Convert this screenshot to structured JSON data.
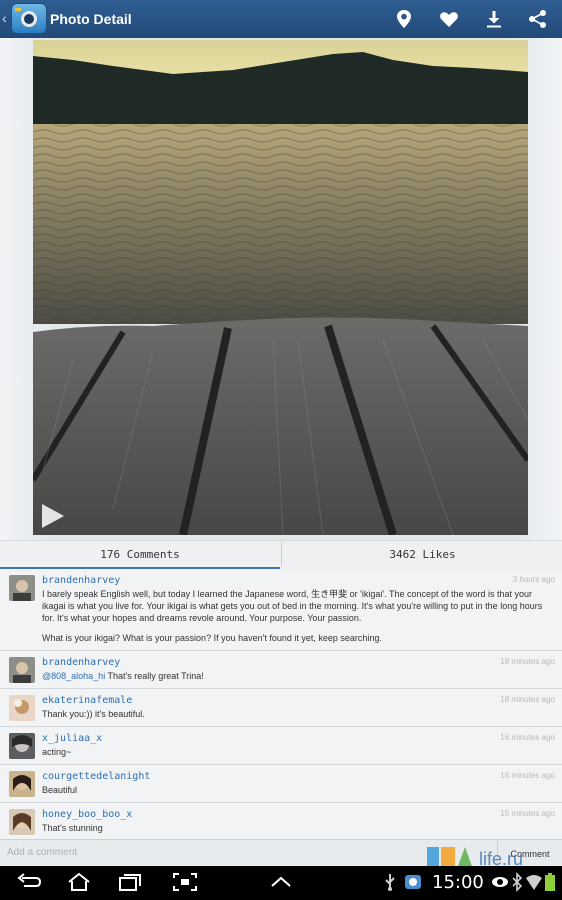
{
  "header": {
    "title": "Photo Detail",
    "icons": [
      "back-chevron",
      "app-logo",
      "location-pin-icon",
      "heart-icon",
      "download-icon",
      "share-icon"
    ]
  },
  "tabs": {
    "comments": "176 Comments",
    "likes": "3462 Likes"
  },
  "comments": [
    {
      "user": "brandenharvey",
      "time": "3 hours ago",
      "text": "I barely speak English well, but today I learned the Japanese word, 生き甲斐 or 'ikigai'. The concept of the word is that your ikagai is what you live for. Your ikigai is what gets you out of bed in the morning. It's what you're willing to put in the long hours for. It's what your hopes and dreams revole around. Your purpose. Your passion.",
      "text2": "What is your ikigai? What is your passion? If you haven't found it yet, keep searching."
    },
    {
      "user": "brandenharvey",
      "time": "18 minutes ago",
      "mention": "@808_aloha_hi",
      "text": " That's really great Trina!"
    },
    {
      "user": "ekaterinafemale",
      "time": "18 minutes ago",
      "text": "Thank you:)) it's beautiful."
    },
    {
      "user": "x_juliaa_x",
      "time": "16 minutes ago",
      "text": "acting~"
    },
    {
      "user": "courgettedelanight",
      "time": "16 minutes ago",
      "text": "Beautiful"
    },
    {
      "user": "honey_boo_boo_x",
      "time": "15 minutes ago",
      "text": "That's stunning"
    }
  ],
  "add_comment": {
    "placeholder": "Add a comment",
    "button": "Comment"
  },
  "status": {
    "time": "15:00",
    "watermark": "life.ru"
  },
  "colors": {
    "topbar": "#2a5585",
    "link": "#2d6fb1",
    "tab_indicator": "#3a77b8"
  }
}
